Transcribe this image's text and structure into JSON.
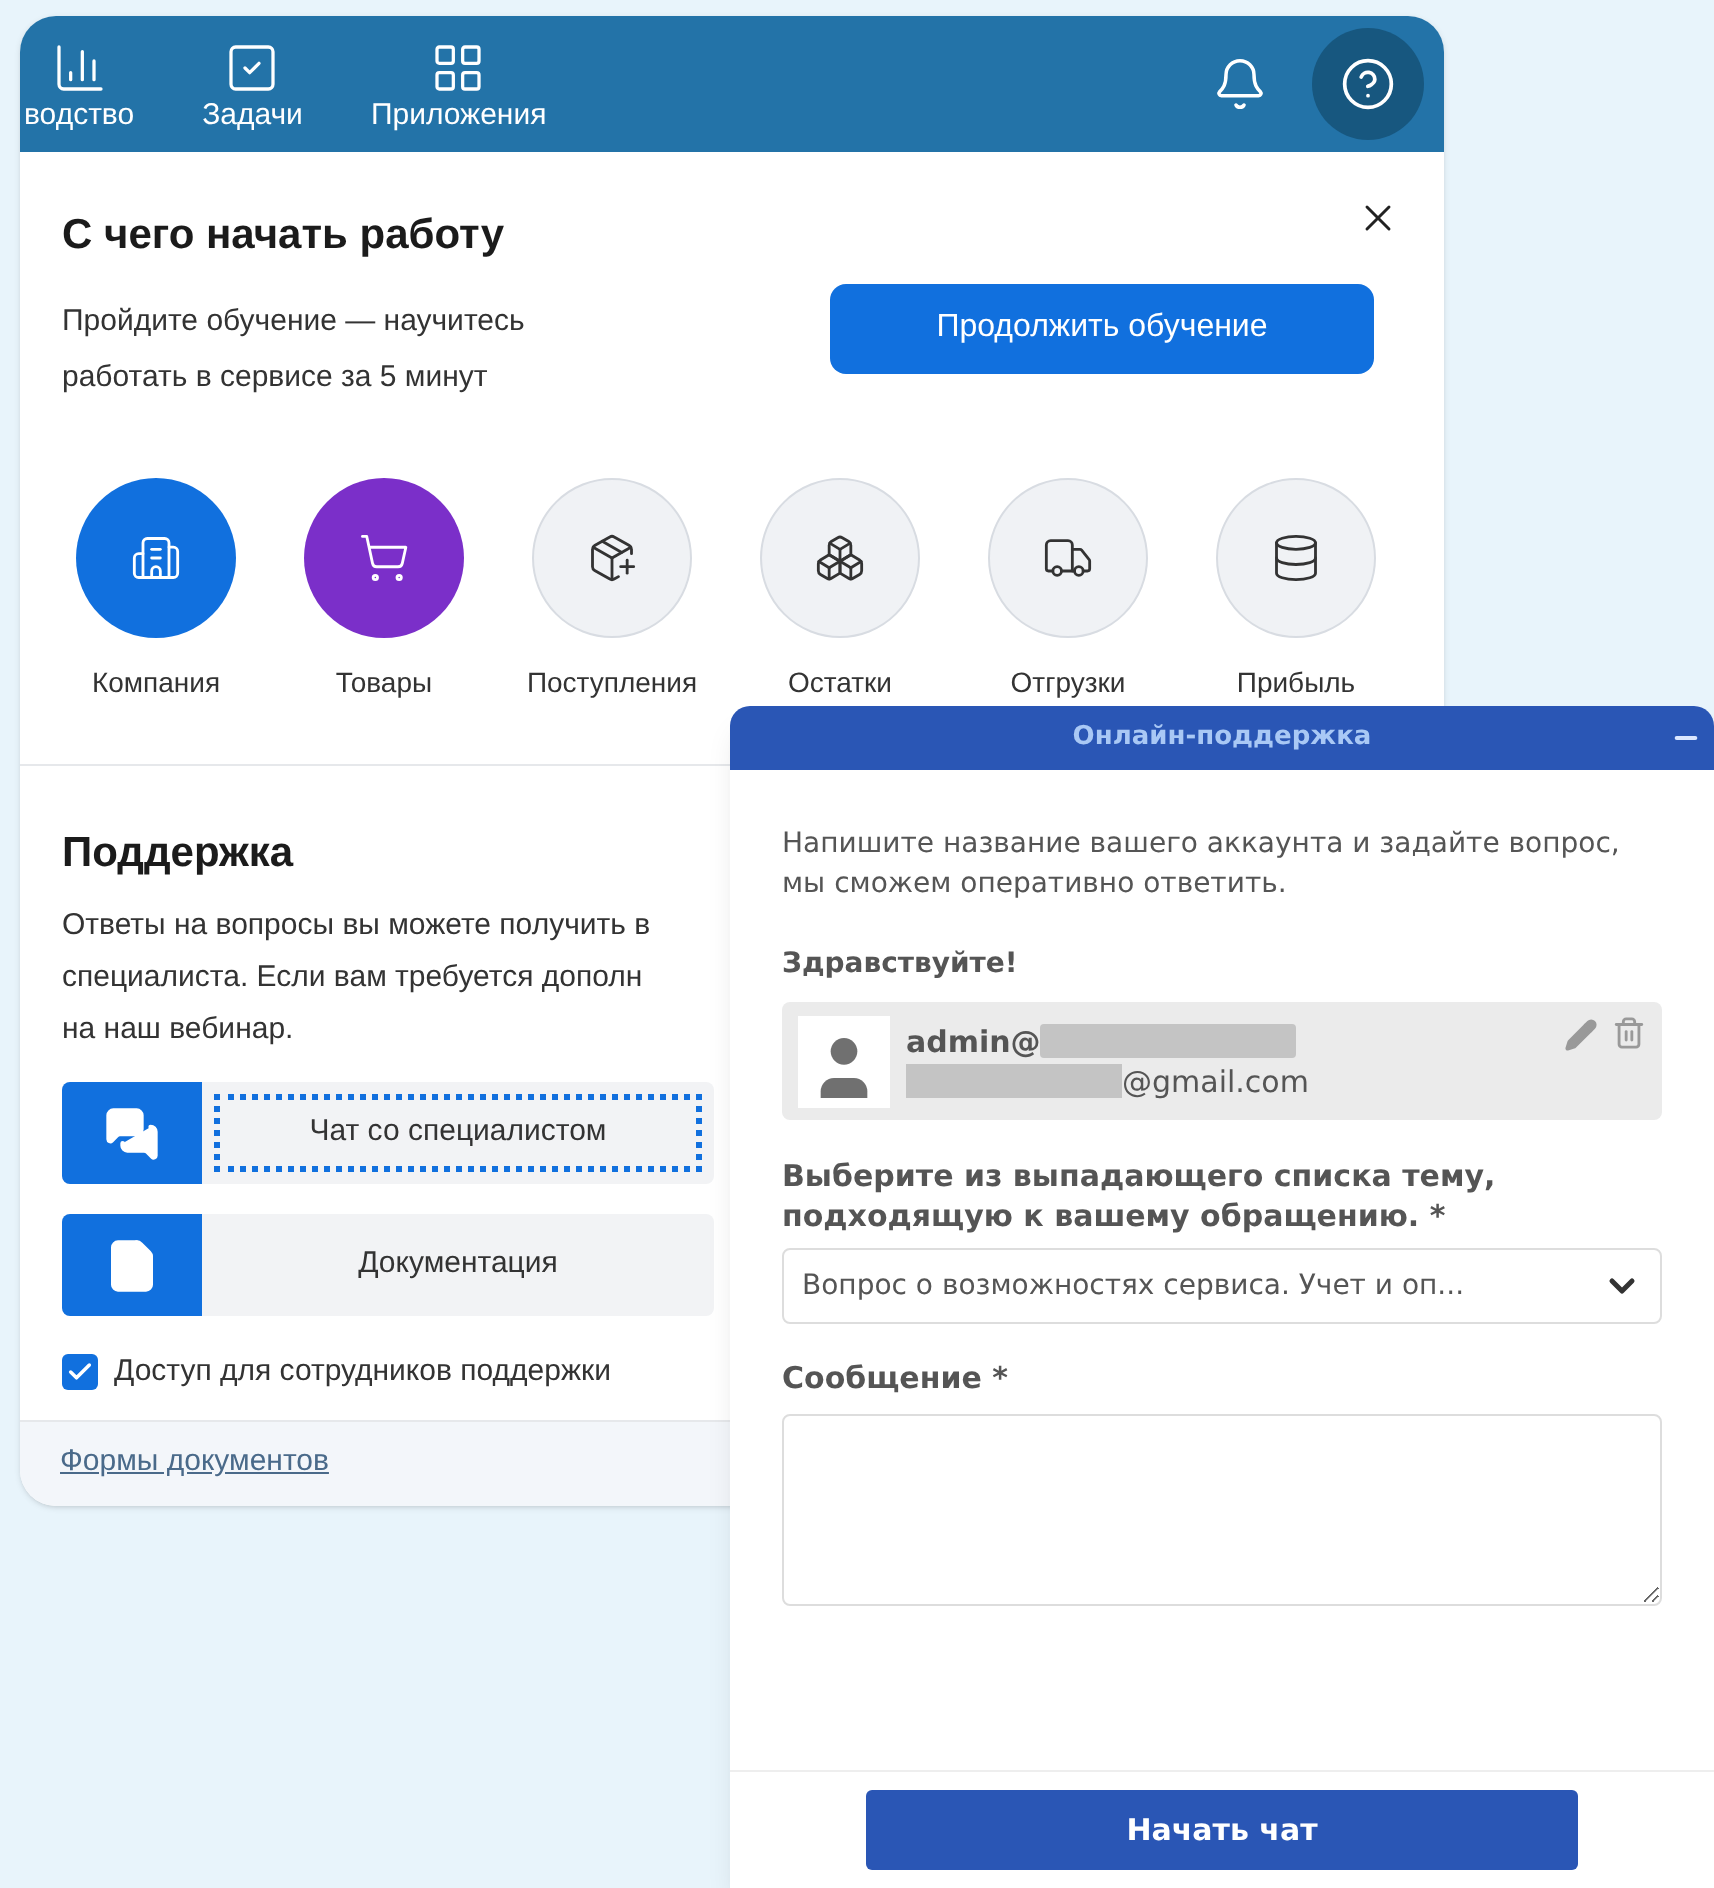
{
  "top_nav": {
    "items": [
      {
        "label": "водство",
        "kind": "chart"
      },
      {
        "label": "Задачи",
        "kind": "tasks"
      },
      {
        "label": "Приложения",
        "kind": "apps"
      }
    ],
    "help_active": true
  },
  "onboarding": {
    "title": "С чего начать работу",
    "description_lines": [
      "Пройдите обучение — научитесь",
      "работать в сервисе за 5 минут"
    ],
    "continue_button": "Продолжить обучение",
    "tiles": [
      {
        "label": "Компания",
        "kind": "company",
        "color": "#1170de"
      },
      {
        "label": "Товары",
        "kind": "goods",
        "color": "#7b2fc9"
      },
      {
        "label": "Поступления",
        "kind": "receipts",
        "color": "#f0f2f5"
      },
      {
        "label": "Остатки",
        "kind": "stock",
        "color": "#f0f2f5"
      },
      {
        "label": "Отгрузки",
        "kind": "shipments",
        "color": "#f0f2f5"
      },
      {
        "label": "Прибыль",
        "kind": "profit",
        "color": "#f0f2f5"
      }
    ]
  },
  "support": {
    "title": "Поддержка",
    "text_lines": [
      "Ответы на вопросы вы можете получить в",
      "специалиста. Если вам требуется дополн",
      "на наш вебинар."
    ],
    "buttons": [
      {
        "label": "Чат со специалистом",
        "kind": "chat",
        "focused": true
      },
      {
        "label": "Документация",
        "kind": "docs",
        "focused": false
      }
    ],
    "access_checkbox": {
      "label": "Доступ для сотрудников поддержки",
      "checked": true
    },
    "footer_link": "Формы документов"
  },
  "chat_window": {
    "title": "Онлайн-поддержка",
    "intro": "Напишите название вашего аккаунта и задайте вопрос, мы сможем оперативно ответить.",
    "greeting": "Здравствуйте!",
    "account": {
      "name": "admin@",
      "email": "@gmail.com"
    },
    "topic_label": "Выберите из выпадающего списка тему, подходящую к вашему обращению. *",
    "topic_value": "Вопрос о возможностях сервиса. Учет и оп...",
    "message_label": "Сообщение *",
    "start_button": "Начать чат"
  }
}
